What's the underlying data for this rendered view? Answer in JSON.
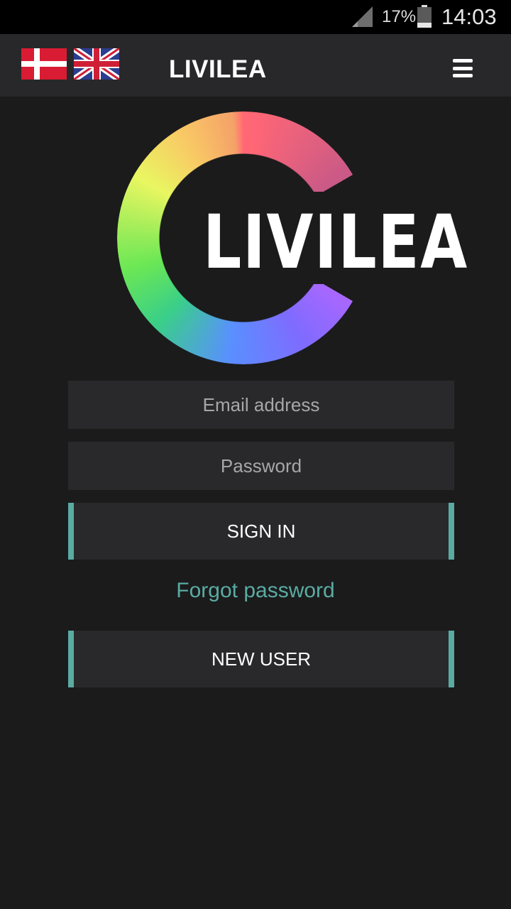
{
  "status_bar": {
    "battery_percent": "17%",
    "time": "14:03",
    "icons": [
      "signal-icon",
      "battery-icon"
    ]
  },
  "app_bar": {
    "title": "LIVILEA",
    "languages": [
      "danish-flag-icon",
      "uk-flag-icon"
    ],
    "menu_icon": "hamburger-menu-icon"
  },
  "logo": {
    "text": "LIVILEA"
  },
  "login_form": {
    "email_placeholder": "Email address",
    "email_value": "",
    "password_placeholder": "Password",
    "password_value": "",
    "sign_in_label": "SIGN IN",
    "forgot_password_label": "Forgot password",
    "new_user_label": "NEW USER"
  },
  "colors": {
    "background": "#1b1b1c",
    "app_bar": "#28282a",
    "field": "#29292b",
    "accent": "#5aaba2"
  }
}
